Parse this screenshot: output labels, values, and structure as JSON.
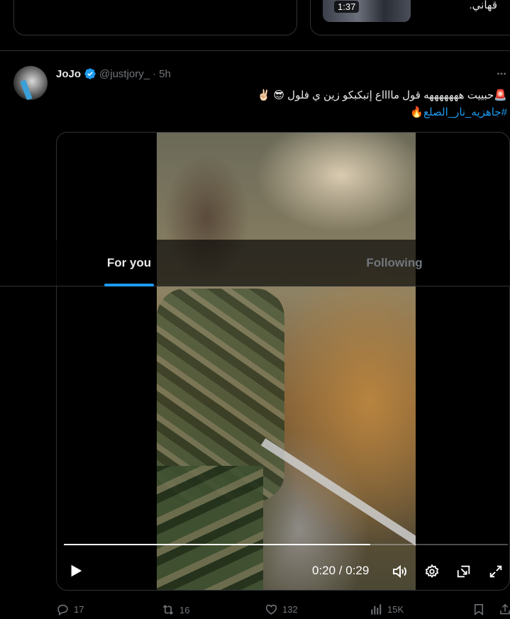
{
  "previous_tweet": {
    "video_duration": "1:37",
    "text_fragment": "قهاني."
  },
  "tweet": {
    "display_name": "JoJo",
    "handle": "@justjory_",
    "separator": "·",
    "time": "5h",
    "text_line1": "🚨حبييت هههههههه قول مااااع إتبكبكو زين ي فلول 😎 ✌🏻",
    "text_line2": "#جاهزيه_نار_الصلع🔥",
    "media": {
      "current_time": "0:20",
      "duration": "0:29",
      "time_readout": "0:20 / 0:29",
      "progress_fraction": 0.69
    },
    "stats": {
      "replies": "17",
      "reposts": "16",
      "likes": "132",
      "views": "15K"
    }
  },
  "overlay_tabs": {
    "for_you": "For you",
    "following": "Following",
    "active": "For you"
  },
  "colors": {
    "accent": "#1d9bf0",
    "background": "#000000",
    "muted_text": "#71767b",
    "border": "#2f3336"
  }
}
